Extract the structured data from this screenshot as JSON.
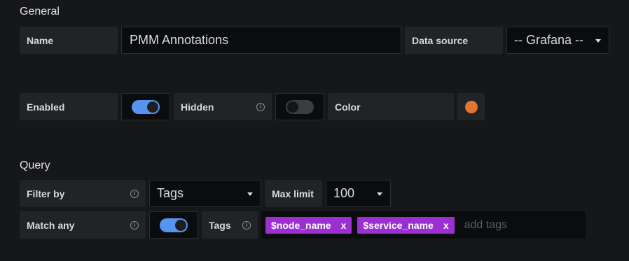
{
  "general": {
    "title": "General",
    "name_label": "Name",
    "name_value": "PMM Annotations",
    "datasource_label": "Data source",
    "datasource_value": "-- Grafana --",
    "enabled_label": "Enabled",
    "enabled_on": true,
    "hidden_label": "Hidden",
    "hidden_on": false,
    "color_label": "Color",
    "color_value": "#e07534"
  },
  "query": {
    "title": "Query",
    "filter_by_label": "Filter by",
    "filter_by_value": "Tags",
    "max_limit_label": "Max limit",
    "max_limit_value": "100",
    "match_any_label": "Match any",
    "match_any_on": true,
    "tags_label": "Tags",
    "tags": [
      {
        "label": "$node_name",
        "remove": "x"
      },
      {
        "label": "$service_name",
        "remove": "x"
      }
    ],
    "tags_placeholder": "add tags"
  },
  "icons": {
    "info": "info-icon",
    "caret": "chevron-down-icon"
  },
  "colors": {
    "switch_on": "#5794f2",
    "tag_bg": "#9b2fd0"
  }
}
